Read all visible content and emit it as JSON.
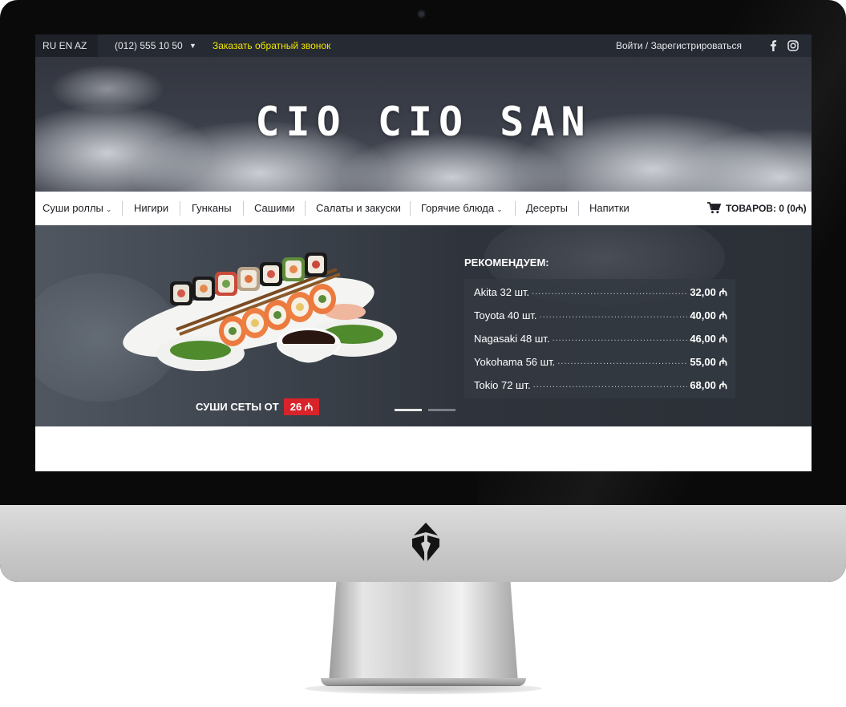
{
  "topbar": {
    "languages": "RU EN AZ",
    "phone": "(012) 555 10 50",
    "phone_caret": "▼",
    "callback": "Заказать обратный звонок",
    "auth": "Войти / Зарегистрироваться",
    "social_icons": [
      "facebook-icon",
      "instagram-icon"
    ]
  },
  "brand": {
    "logo": "CIO CIO SAN"
  },
  "nav": {
    "items": [
      {
        "label": "Суши роллы",
        "has_dropdown": true
      },
      {
        "label": "Нигири",
        "has_dropdown": false
      },
      {
        "label": "Гунканы",
        "has_dropdown": false
      },
      {
        "label": "Сашими",
        "has_dropdown": false
      },
      {
        "label": "Салаты и закуски",
        "has_dropdown": false
      },
      {
        "label": "Горячие блюда",
        "has_dropdown": true
      },
      {
        "label": "Десерты",
        "has_dropdown": false
      },
      {
        "label": "Напитки",
        "has_dropdown": false
      }
    ],
    "chevron": "⌄",
    "cart": "ТОВАРОВ: 0 (0₼)",
    "cart_icon": "cart-icon"
  },
  "slider": {
    "promo_text": "СУШИ СЕТЫ ОТ",
    "promo_price": "26 ₼",
    "active_slide": 1,
    "slide_count": 2,
    "recommend_title": "РЕКОМЕНДУЕМ:",
    "recommendations": [
      {
        "name": "Akita 32 шт.",
        "price": "32,00 ₼"
      },
      {
        "name": "Toyota 40 шт.",
        "price": "40,00 ₼"
      },
      {
        "name": "Nagasaki  48 шт.",
        "price": "46,00 ₼"
      },
      {
        "name": "Yokohama 56 шт.",
        "price": "55,00 ₼"
      },
      {
        "name": "Tokio 72 шт.",
        "price": "68,00 ₼"
      }
    ],
    "leader": "................................................................................................"
  },
  "colors": {
    "accent_yellow": "#f2e600",
    "promo_red": "#d8232a",
    "topbar_bg": "#262a32",
    "dot_active": "#e6e6e6",
    "dot_inactive": "#7b7f87"
  }
}
